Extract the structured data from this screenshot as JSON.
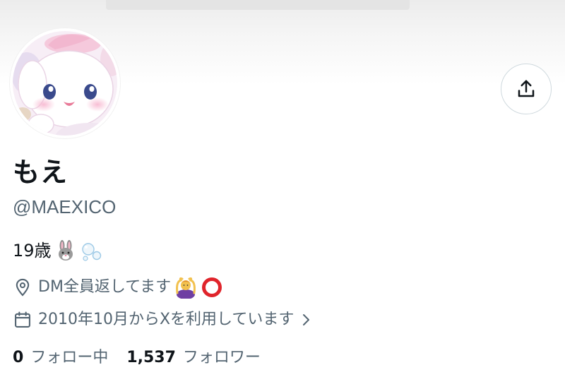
{
  "profile": {
    "display_name": "もえ",
    "handle": "@MAEXICO",
    "bio": "19歳",
    "bio_emojis": [
      "rabbit-emoji",
      "bubbles-emoji"
    ],
    "location": "DM全員返してます",
    "location_emojis": [
      "person-gesturing-ok-emoji",
      "hollow-red-circle-emoji"
    ],
    "joined": "2010年10月からXを利用しています",
    "following_count": "0",
    "following_label": "フォロー中",
    "followers_count": "1,537",
    "followers_label": "フォロワー"
  },
  "icons": {
    "share": "share-upload-icon",
    "location": "location-pin-icon",
    "calendar": "calendar-icon",
    "chevron": "chevron-right-icon"
  },
  "colors": {
    "text_primary": "#0f1419",
    "text_secondary": "#536471",
    "border": "#cfd9de"
  }
}
